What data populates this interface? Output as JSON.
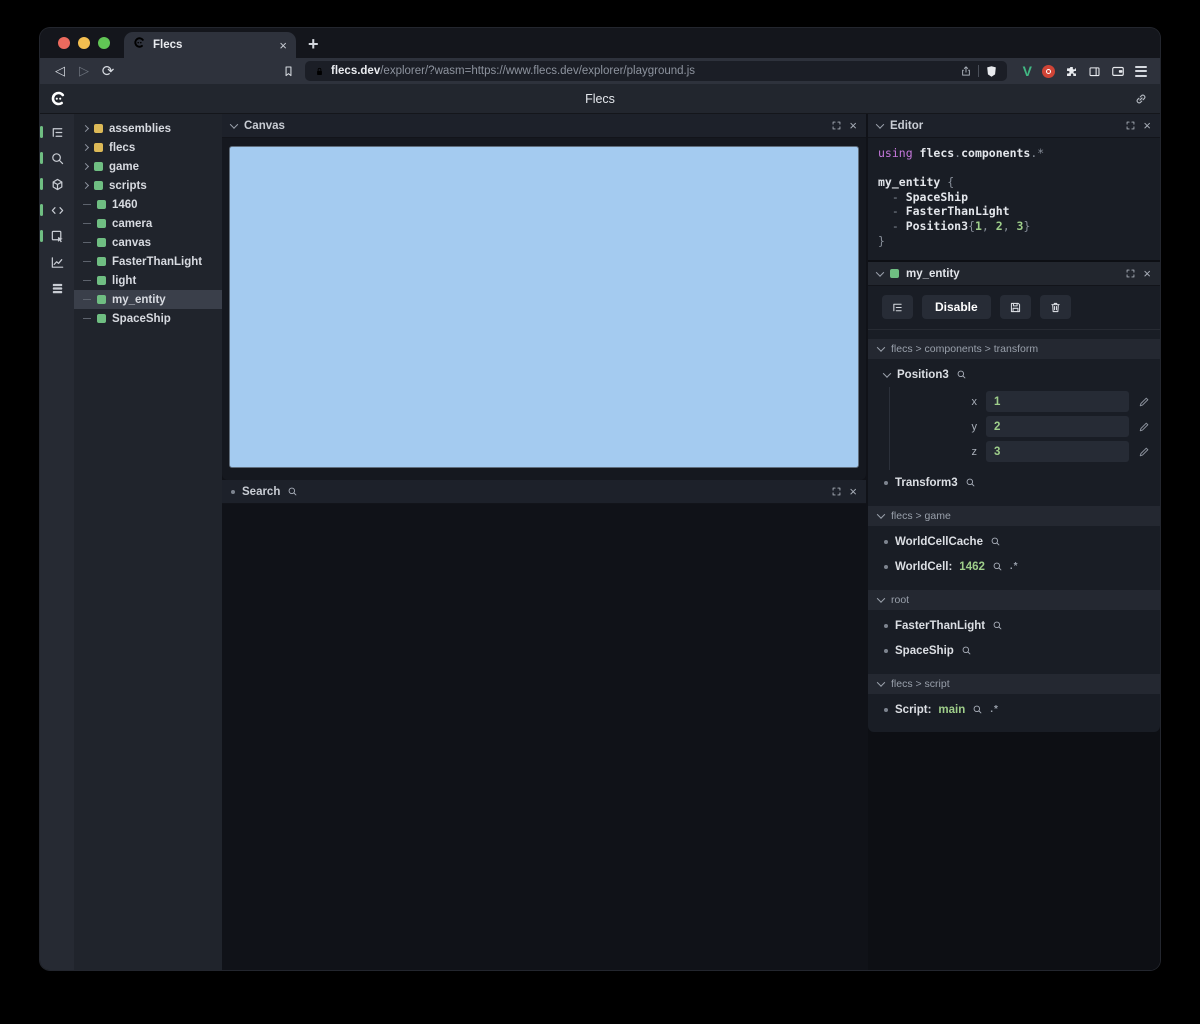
{
  "colors": {
    "traffic_red": "#ec6a5e",
    "traffic_yellow": "#f4bf50",
    "traffic_green": "#61c555",
    "accent_green": "#6fbe82",
    "accent_yellow": "#dcb957",
    "canvas_blue": "#a4cbf0",
    "value_green": "#9ece8a",
    "keyword_purple": "#c678dd"
  },
  "icons": {
    "close_glyph": "×",
    "new_tab_glyph": "+",
    "back_glyph": "◁",
    "forward_glyph": "▷",
    "reload_glyph": "⟳"
  },
  "browser": {
    "tab_title": "Flecs",
    "url_domain": "flecs.dev",
    "url_rest": "/explorer/?wasm=https://www.flecs.dev/explorer/playground.js"
  },
  "app_header": {
    "title": "Flecs"
  },
  "icon_strip": [
    {
      "icon": "tree",
      "active": true
    },
    {
      "icon": "search",
      "active": true
    },
    {
      "icon": "cube",
      "active": true
    },
    {
      "icon": "code",
      "active": true
    },
    {
      "icon": "inspect",
      "active": true
    },
    {
      "icon": "chart",
      "active": false
    },
    {
      "icon": "stack",
      "active": false
    }
  ],
  "tree_items": [
    {
      "label": "assemblies",
      "expandable": true,
      "square": "yellow"
    },
    {
      "label": "flecs",
      "expandable": true,
      "square": "yellow"
    },
    {
      "label": "game",
      "expandable": true,
      "square": "green"
    },
    {
      "label": "scripts",
      "expandable": true,
      "square": "green"
    },
    {
      "label": "1460",
      "expandable": false,
      "square": "green"
    },
    {
      "label": "camera",
      "expandable": false,
      "square": "green"
    },
    {
      "label": "canvas",
      "expandable": false,
      "square": "green"
    },
    {
      "label": "FasterThanLight",
      "expandable": false,
      "square": "green"
    },
    {
      "label": "light",
      "expandable": false,
      "square": "green"
    },
    {
      "label": "my_entity",
      "expandable": false,
      "square": "green",
      "selected": true
    },
    {
      "label": "SpaceShip",
      "expandable": false,
      "square": "green"
    }
  ],
  "canvas_panel": {
    "title": "Canvas"
  },
  "search_panel": {
    "title": "Search"
  },
  "editor_panel": {
    "title": "Editor",
    "code_lines": [
      [
        {
          "text": "using ",
          "type": "keyword"
        },
        {
          "text": "flecs",
          "type": "ident"
        },
        {
          "text": ".",
          "type": "punct"
        },
        {
          "text": "components",
          "type": "ident"
        },
        {
          "text": ".*",
          "type": "punct"
        }
      ],
      [],
      [
        {
          "text": "my_entity ",
          "type": "ident"
        },
        {
          "text": "{",
          "type": "punct"
        }
      ],
      [
        {
          "text": "  - ",
          "type": "punct"
        },
        {
          "text": "SpaceShip",
          "type": "ident"
        }
      ],
      [
        {
          "text": "  - ",
          "type": "punct"
        },
        {
          "text": "FasterThanLight",
          "type": "ident"
        }
      ],
      [
        {
          "text": "  - ",
          "type": "punct"
        },
        {
          "text": "Position3",
          "type": "ident"
        },
        {
          "text": "{",
          "type": "punct"
        },
        {
          "text": "1",
          "type": "number"
        },
        {
          "text": ", ",
          "type": "punct"
        },
        {
          "text": "2",
          "type": "number"
        },
        {
          "text": ", ",
          "type": "punct"
        },
        {
          "text": "3",
          "type": "number"
        },
        {
          "text": "}",
          "type": "punct"
        }
      ],
      [
        {
          "text": "}",
          "type": "punct"
        }
      ]
    ]
  },
  "inspector": {
    "title": "my_entity",
    "toolbar": {
      "disable_label": "Disable"
    },
    "sections": [
      {
        "path": "flecs > components > transform",
        "items": [
          {
            "label": "Position3",
            "expanded": true,
            "fields": [
              {
                "key": "x",
                "value": "1"
              },
              {
                "key": "y",
                "value": "2"
              },
              {
                "key": "z",
                "value": "3"
              }
            ]
          },
          {
            "label": "Transform3"
          }
        ]
      },
      {
        "path": "flecs > game",
        "items": [
          {
            "label": "WorldCellCache"
          },
          {
            "label": "WorldCell",
            "value": "1462",
            "suffix": ".*"
          }
        ]
      },
      {
        "path": "root",
        "items": [
          {
            "label": "FasterThanLight"
          },
          {
            "label": "SpaceShip"
          }
        ]
      },
      {
        "path": "flecs > script",
        "items": [
          {
            "label": "Script",
            "value": "main",
            "suffix": ".*"
          }
        ]
      }
    ]
  }
}
